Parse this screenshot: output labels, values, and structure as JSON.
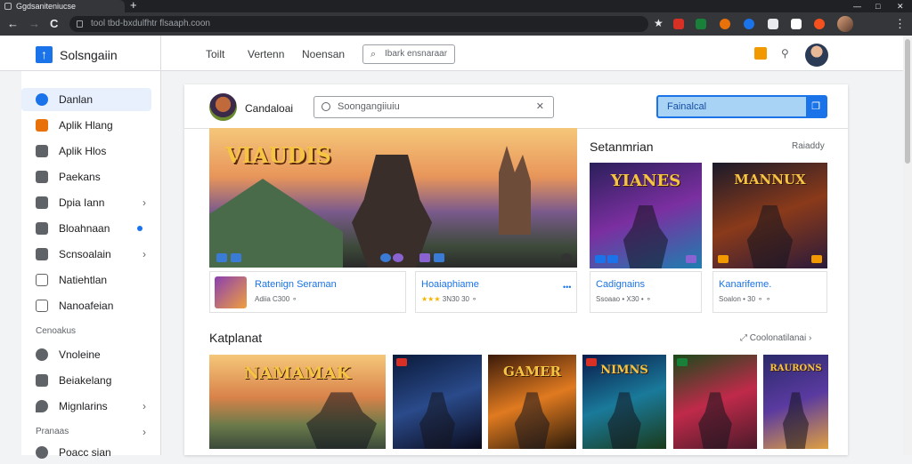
{
  "browser": {
    "tab_title": "Ggdsaniteniucse",
    "url": "tool tbd-bxdulfhtr flsaaph.coon",
    "new_tab_glyph": "+",
    "back_glyph": "←",
    "forward_glyph": "→",
    "reload_glyph": "C",
    "star_glyph": "★",
    "minimize_glyph": "—",
    "restore_glyph": "□",
    "close_glyph": "✕"
  },
  "header": {
    "app_name": "Solsngaiin",
    "nav": [
      "Toilt",
      "Vertenn",
      "Noensan"
    ],
    "search_placeholder": "Ibark ensnaraar"
  },
  "sidebar": {
    "items": [
      {
        "label": "Danlan",
        "icon": "compass-icon",
        "color": "#1a73e8",
        "active": true
      },
      {
        "label": "Aplik Hlang",
        "icon": "apps-icon",
        "color": "#e8710a"
      },
      {
        "label": "Aplik Hlos",
        "icon": "grid-icon",
        "color": "#5f6368"
      },
      {
        "label": "Paekans",
        "icon": "package-icon",
        "color": "#5f6368"
      },
      {
        "label": "Dpia Iann",
        "icon": "folder-icon",
        "color": "#5f6368",
        "chevron": "›"
      },
      {
        "label": "Bloahnaan",
        "icon": "chart-icon",
        "color": "#5f6368",
        "dot": true
      },
      {
        "label": "Scnsoalain",
        "icon": "settings-icon",
        "color": "#5f6368",
        "chevron": "›"
      },
      {
        "label": "Natiehtlan",
        "icon": "notification-icon",
        "color": "#5f6368"
      },
      {
        "label": "Nanoafeian",
        "icon": "list-icon",
        "color": "#5f6368"
      }
    ],
    "section_label": "Cenoakus",
    "items2": [
      {
        "label": "Vnoleine",
        "icon": "shield-icon",
        "color": "#5f6368"
      },
      {
        "label": "Beiakelang",
        "icon": "tag-icon",
        "color": "#5f6368"
      },
      {
        "label": "Mignlarins",
        "icon": "pin-icon",
        "color": "#5f6368",
        "chevron": "›"
      }
    ],
    "section2_label": "Pranaas",
    "section2_chevron": "›",
    "items3": [
      {
        "label": "Poacc sian",
        "icon": "user-icon",
        "color": "#5f6368"
      }
    ]
  },
  "main": {
    "channel_name": "Candaloai",
    "search_placeholder": "Soongangiiuiu",
    "search_clear_glyph": "✕",
    "cta_label": "Fainalcal",
    "hero_title": "VIAUDIS",
    "featured_cards": [
      {
        "title": "Ratenign Seraman",
        "meta": "Adiia C300  ⚬"
      },
      {
        "title": "Hoaiaphiame",
        "meta": "3N30  30  ⚬",
        "stars": "★★★"
      }
    ],
    "side_section": {
      "title": "Setanmrian",
      "link": "Raiaddy"
    },
    "side_apps": [
      {
        "tile_title": "YIANES",
        "card_title": "Cadignains",
        "meta": "Ssoaao  •  X30  •  ⚬"
      },
      {
        "tile_title": "MANNUX",
        "card_title": "Kanarifeme.",
        "meta": "Soalon  •  30  ⚬  ⚬"
      }
    ],
    "section2": {
      "title": "Katplanat",
      "link": "Coolonatilanai ›",
      "link_icon": "⤢"
    },
    "grid_tiles": [
      {
        "title": "NAMAMAK"
      },
      {
        "title": ""
      },
      {
        "title": "GAMER"
      },
      {
        "title": "NIMNS"
      },
      {
        "title": ""
      },
      {
        "title": "RAURONS"
      }
    ]
  },
  "colors": {
    "accent": "#1a73e8",
    "cta_fill": "#a8d3f5",
    "link_text": "#1a73e8"
  }
}
